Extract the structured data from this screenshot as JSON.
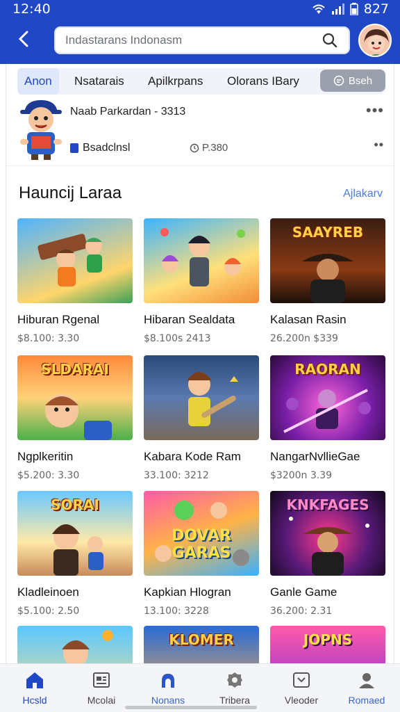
{
  "status_bar": {
    "time": "12:40",
    "battery": "827"
  },
  "header": {
    "search_placeholder": "Indastarans Indonasm"
  },
  "tabs": {
    "items": [
      {
        "label": "Anon"
      },
      {
        "label": "Nsatarais"
      },
      {
        "label": "Apilkrpans"
      },
      {
        "label": "Olorans IBary"
      }
    ],
    "action_label": "Bseh"
  },
  "profile": {
    "title": "Naab Parkardan - 3313",
    "subtitle": "Bsadclnsl",
    "price": "P.380"
  },
  "section": {
    "title": "Hauncij Laraa",
    "link": "Ajlakarv"
  },
  "cards": [
    {
      "title": "Hiburan Rgenal",
      "sub": "$8.100: 3.30",
      "art": ""
    },
    {
      "title": "Hibaran Sealdata",
      "sub": "$8.100s 2413",
      "art": ""
    },
    {
      "title": "Kalasan Rasin",
      "sub": "26.200n $339",
      "art": "SAAYREB"
    },
    {
      "title": "Ngplkeritin",
      "sub": "$5.200: 3.30",
      "art": "SLDARAI"
    },
    {
      "title": "Kabara Kode Ram",
      "sub": "33.100: 3212",
      "art": ""
    },
    {
      "title": "NangarNvllieGae",
      "sub": "$3200n 3.39",
      "art": "RAORAN"
    },
    {
      "title": "Kladleinoen",
      "sub": "$5.100: 2.50",
      "art": "SORAI"
    },
    {
      "title": "Kapkian Hlogran",
      "sub": "13.100: 3228",
      "art": "DOVAR GARAS"
    },
    {
      "title": "Ganle Game",
      "sub": "36.200: 2.31",
      "art": "KNKFAGES"
    },
    {
      "title": "",
      "sub": "",
      "art": ""
    },
    {
      "title": "",
      "sub": "",
      "art": "KLOMER"
    },
    {
      "title": "",
      "sub": "",
      "art": "JOPNS"
    }
  ],
  "bottom_nav": [
    {
      "label": "Hcsld",
      "icon": "home-icon"
    },
    {
      "label": "Mcolai",
      "icon": "news-icon"
    },
    {
      "label": "Nonans",
      "icon": "person-icon"
    },
    {
      "label": "Tribera",
      "icon": "gear-icon"
    },
    {
      "label": "Vleoder",
      "icon": "video-icon"
    },
    {
      "label": "Romaed",
      "icon": "profile-icon"
    }
  ],
  "colors": {
    "brand": "#1f47c6",
    "link": "#4a7bd8"
  }
}
